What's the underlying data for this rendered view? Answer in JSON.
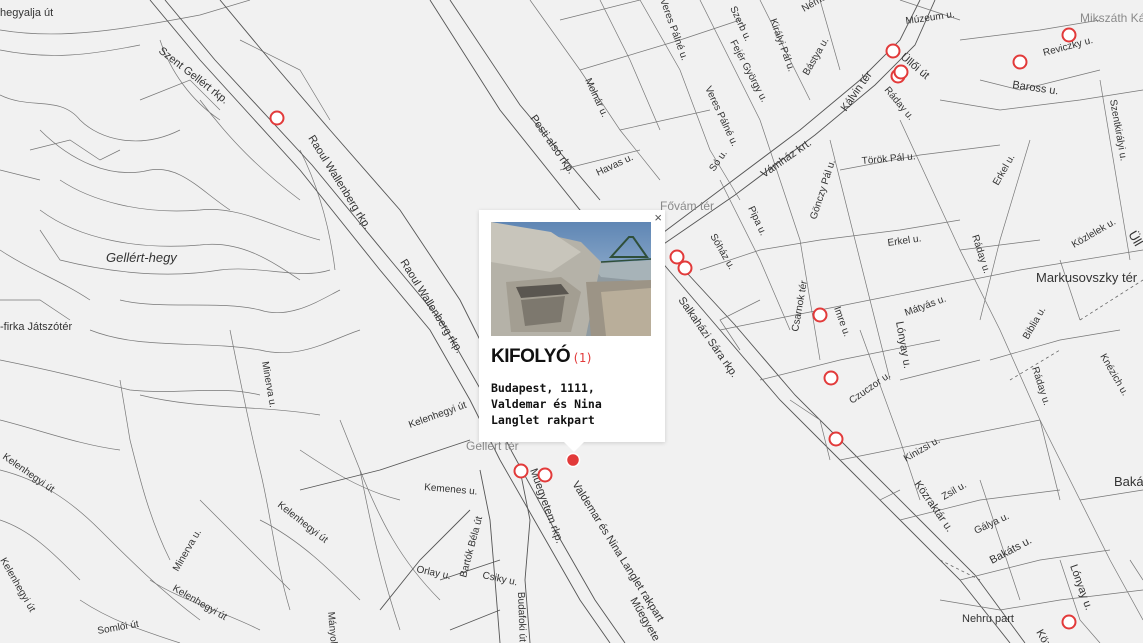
{
  "streets": {
    "hegyalja": "hegyalja út",
    "szent_gellert": "Szent Gellért rkp.",
    "raoul1": "Raoul Wallenberg rkp.",
    "raoul2": "Raoul Wallenberg rkp.",
    "gellert_hegy": "Gellért-hegy",
    "jatszoter": "-firka Játszótér",
    "minerva1": "Minerva u.",
    "kelenhegyi1": "Kelenhegyi út",
    "kelenhegyi2": "Kelenhegyi út",
    "kelenhegyi3": "Kelenhegyi út",
    "kelenhegyi4": "Kelenhegyi út",
    "minerva2": "Minerva u.",
    "kemenes": "Kemenes u.",
    "bartok": "Bartók Béla út",
    "orlay": "Orlay u.",
    "csiky": "Csiky u.",
    "somloi": "Somlói út",
    "manyoki": "Mányoki",
    "budafoki": "Budafoki út",
    "muegyetem": "Műegyetem rkp.",
    "valdemar": "Valdemar és Nina Langlet rakpart",
    "muegyete2": "Műegyete",
    "pesti_also": "Pesti alsó rkp.",
    "molnar": "Molnár u.",
    "havas": "Havas u.",
    "veres1": "Veres Pálné u.",
    "veres2": "Veres Pálné u.",
    "szerb": "Szerb u.",
    "fejer": "Fejér György u.",
    "kiraly": "Királyi Pál u.",
    "bastya": "Bástya u.",
    "nemeti": "Németi u.",
    "kalvin": "Kálvin tér",
    "vamhaz": "Vámház krt.",
    "so": "Só u.",
    "fovam": "Fővám tér",
    "muzeum": "Múzeum u.",
    "mikszath": "Mikszáth Kálmán tér",
    "reviczky": "Reviczky u.",
    "ulloi": "Üllői út",
    "baross": "Baross u.",
    "raday1": "Ráday u.",
    "raday2": "Ráday u.",
    "raday3": "Ráday u.",
    "torok": "Török Pál u.",
    "erkel1": "Erkel u.",
    "erkel2": "Erkel u.",
    "szentkiralyi": "Szentkirályi u.",
    "gonczy": "Gönczy Pál u.",
    "pipa": "Pipa u.",
    "sohaz": "Sóház u.",
    "salkahazi": "Salkaházi Sára rkp.",
    "csarnok": "Csarnok tér",
    "imre": "Imre u.",
    "matyas": "Mátyás u.",
    "lonyay1": "Lónyay u.",
    "lonyay2": "Lónyay u.",
    "kozlelek": "Közlelek u.",
    "markusovszky": "Markusovszky tér",
    "biblia": "Biblia u.",
    "knezich": "Knézich u.",
    "czuczor": "Czuczor u.",
    "kinizsi": "Kinizsi u.",
    "kozraktar": "Közraktár u.",
    "zsil": "Zsil u.",
    "galya": "Gálya u.",
    "bakats": "Bakáts u.",
    "baka": "Baká",
    "nehru": "Nehru part",
    "koz": "Köz",
    "ull": "Üll",
    "gellert_ter": "Gellért tér",
    "kelenhegyi_top": "Kelenhegyi út"
  },
  "popup": {
    "close": "×",
    "title": "KIFOLYÓ",
    "count": "(1)",
    "address": "Budapest, 1111, Valdemar és Nina Langlet rakpart"
  },
  "colors": {
    "marker": "#e23a3a",
    "background": "#f1f1f1"
  }
}
